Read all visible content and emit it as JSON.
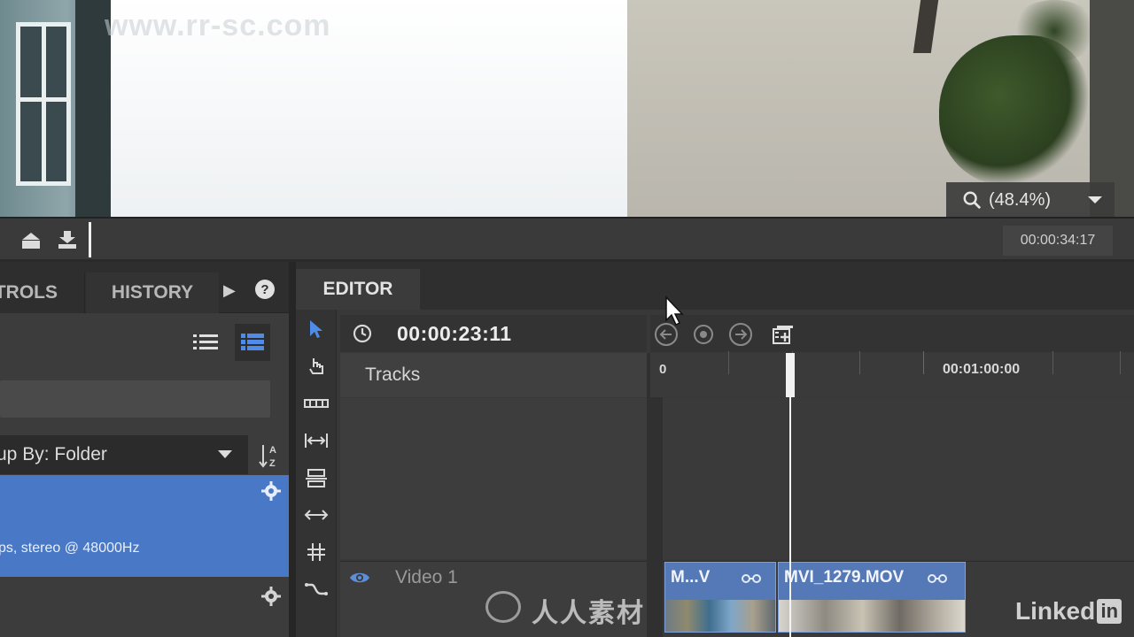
{
  "watermark": {
    "site": "www.rr-sc.com",
    "brand": "人人素材",
    "linkedin_text": "Linked",
    "linkedin_box": "in"
  },
  "viewer": {
    "zoom": "(48.4%)",
    "duration": "00:00:34:17"
  },
  "left_panel": {
    "tabs": [
      "TROLS",
      "HISTORY"
    ],
    "more": "▶",
    "help": "?",
    "group_by": "up By: Folder",
    "sort_label": "AZ",
    "selected_item_meta": "ps, stereo @ 48000Hz"
  },
  "editor": {
    "tab": "EDITOR",
    "current_time": "00:00:23:11",
    "tracks_label": "Tracks",
    "ruler": {
      "start": "0",
      "mark": "00:01:00:00"
    },
    "video_track": "Video 1",
    "clips": [
      {
        "title": "M...V"
      },
      {
        "title": "MVI_1279.MOV"
      }
    ]
  },
  "colors": {
    "accent": "#4878c6",
    "clip": "#5578b6",
    "panel": "#3c3c3c",
    "eye": "#5d8fd9"
  }
}
